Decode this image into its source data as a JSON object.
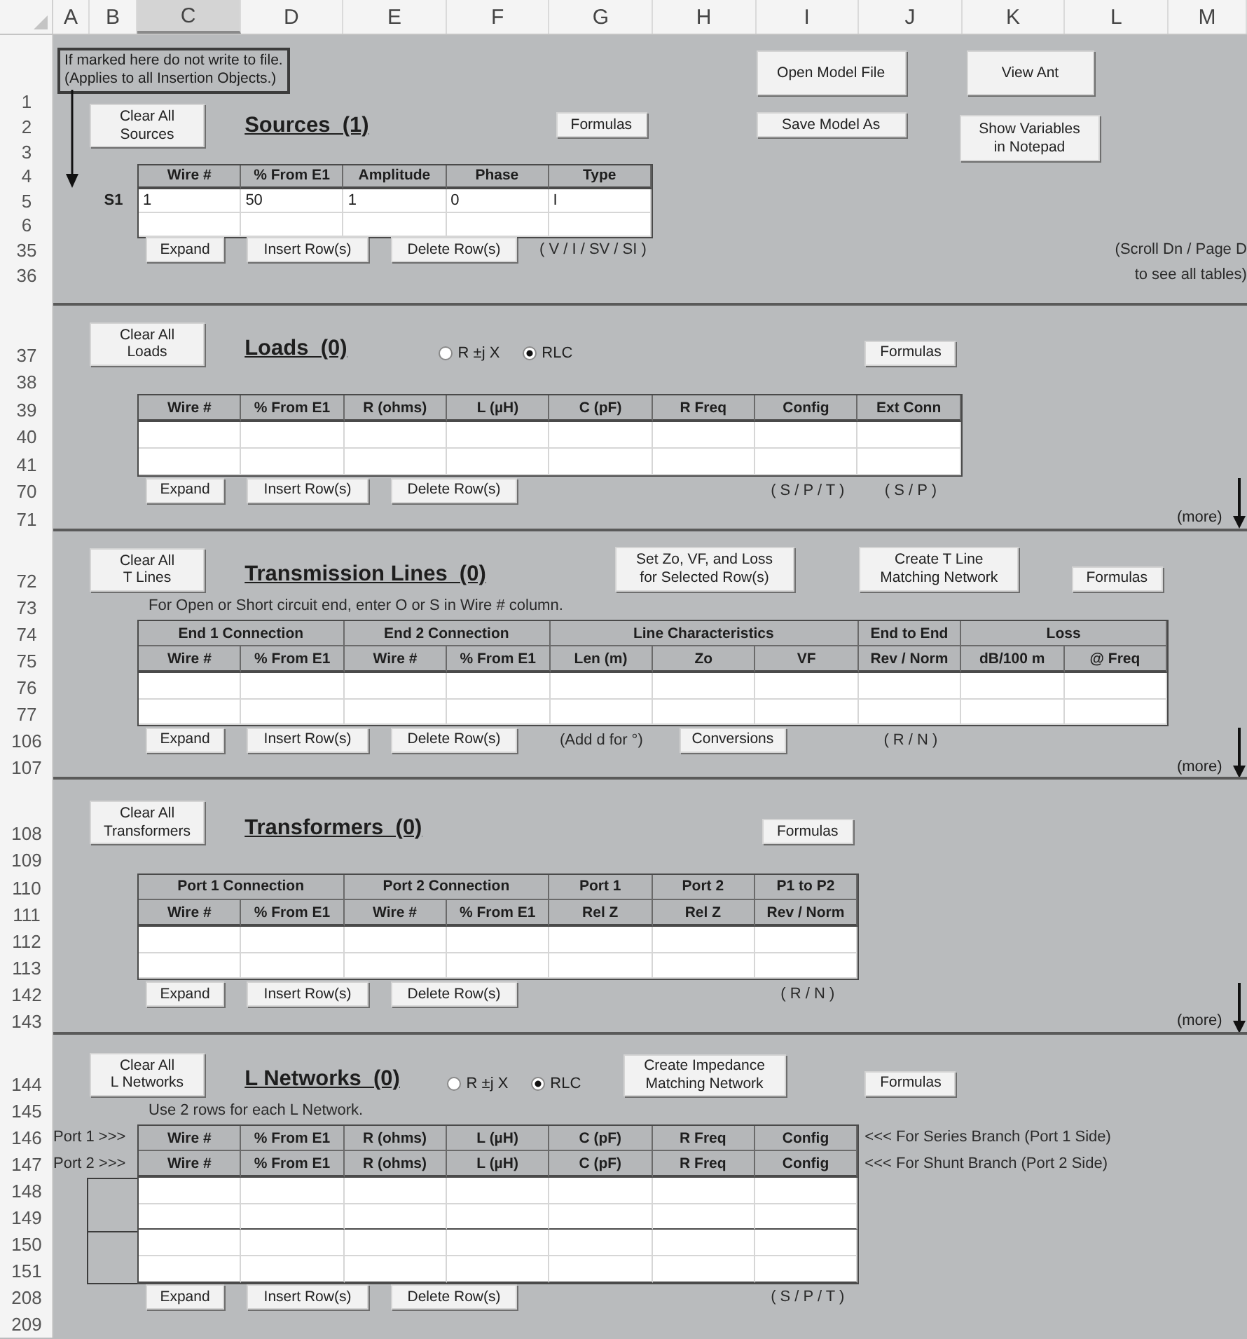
{
  "column_headers": [
    {
      "label": "A",
      "selected": false
    },
    {
      "label": "B",
      "selected": false
    },
    {
      "label": "C",
      "selected": true
    },
    {
      "label": "D",
      "selected": false
    },
    {
      "label": "E",
      "selected": false
    },
    {
      "label": "F",
      "selected": false
    },
    {
      "label": "G",
      "selected": false
    },
    {
      "label": "H",
      "selected": false
    },
    {
      "label": "I",
      "selected": false
    },
    {
      "label": "J",
      "selected": false
    },
    {
      "label": "K",
      "selected": false
    },
    {
      "label": "L",
      "selected": false
    },
    {
      "label": "M",
      "selected": false
    }
  ],
  "sources": {
    "row_numbers": [
      "1",
      "2",
      "3",
      "4",
      "5",
      "6",
      "35",
      "36"
    ],
    "note_box": [
      "If marked here do not write to file.",
      "(Applies to all Insertion Objects.)"
    ],
    "clear_button": [
      "Clear All",
      "Sources"
    ],
    "title": "Sources  (1)",
    "formulas_button": "Formulas",
    "file_buttons": [
      {
        "lines": [
          "Open Model File"
        ]
      },
      {
        "lines": [
          "View Ant"
        ]
      },
      {
        "lines": [
          "Save Model As"
        ]
      },
      {
        "lines": [
          "Show Variables",
          "in Notepad"
        ]
      }
    ],
    "table": {
      "columns": [
        "Wire #",
        "% From E1",
        "Amplitude",
        "Phase",
        "Type"
      ],
      "rows": [
        {
          "label": "S1",
          "cells": [
            "1",
            "50",
            "1",
            "0",
            "I"
          ]
        }
      ]
    },
    "row_buttons": [
      "Expand",
      "Insert Row(s)",
      "Delete Row(s)"
    ],
    "type_hint": "( V / I / SV / SI )",
    "scroll_hint": [
      "(Scroll Dn / Page D",
      "to see all tables)"
    ]
  },
  "loads": {
    "row_numbers": [
      "37",
      "38",
      "39",
      "40",
      "41",
      "70",
      "71"
    ],
    "clear_button": [
      "Clear All",
      "Loads"
    ],
    "title": "Loads  (0)",
    "radios": [
      {
        "label": "R ±j X",
        "selected": false
      },
      {
        "label": "RLC",
        "selected": true
      }
    ],
    "formulas_button": "Formulas",
    "table": {
      "columns": [
        "Wire #",
        "% From E1",
        "R (ohms)",
        "L (µH)",
        "C (pF)",
        "R Freq",
        "Config",
        "Ext Conn"
      ]
    },
    "row_buttons": [
      "Expand",
      "Insert Row(s)",
      "Delete Row(s)"
    ],
    "hints": [
      "( S / P / T )",
      "( S / P )"
    ],
    "more": "(more)"
  },
  "transmission_lines": {
    "row_numbers": [
      "72",
      "73",
      "74",
      "75",
      "76",
      "77",
      "106",
      "107"
    ],
    "clear_button": [
      "Clear All",
      "T Lines"
    ],
    "title": "Transmission Lines  (0)",
    "action_buttons": [
      {
        "lines": [
          "Set Zo, VF, and Loss",
          "for Selected Row(s)"
        ]
      },
      {
        "lines": [
          "Create T Line",
          "Matching Network"
        ]
      }
    ],
    "formulas_button": "Formulas",
    "note": "For Open or Short circuit end, enter O or S in Wire # column.",
    "table": {
      "groups": [
        {
          "label": "End 1 Connection",
          "columns": [
            "Wire #",
            "% From E1"
          ]
        },
        {
          "label": "End 2 Connection",
          "columns": [
            "Wire #",
            "% From E1"
          ]
        },
        {
          "label": "Line Characteristics",
          "columns": [
            "Len (m)",
            "Zo",
            "VF"
          ]
        },
        {
          "label": "End to End",
          "columns": [
            "Rev / Norm"
          ]
        },
        {
          "label": "Loss",
          "columns": [
            "dB/100 m",
            "@ Freq"
          ]
        }
      ]
    },
    "row_buttons": [
      "Expand",
      "Insert Row(s)",
      "Delete Row(s)"
    ],
    "degree_hint": "(Add d for °)",
    "conversions_button": "Conversions",
    "rn_hint": "( R / N )",
    "more": "(more)"
  },
  "transformers": {
    "row_numbers": [
      "108",
      "109",
      "110",
      "111",
      "112",
      "113",
      "142",
      "143"
    ],
    "clear_button": [
      "Clear All",
      "Transformers"
    ],
    "title": "Transformers  (0)",
    "formulas_button": "Formulas",
    "table": {
      "groups": [
        {
          "label": "Port 1 Connection",
          "columns": [
            "Wire #",
            "% From E1"
          ]
        },
        {
          "label": "Port 2 Connection",
          "columns": [
            "Wire #",
            "% From E1"
          ]
        },
        {
          "label": "Port 1",
          "columns": [
            "Rel Z"
          ]
        },
        {
          "label": "Port 2",
          "columns": [
            "Rel Z"
          ]
        },
        {
          "label": "P1 to P2",
          "columns": [
            "Rev / Norm"
          ]
        }
      ]
    },
    "row_buttons": [
      "Expand",
      "Insert Row(s)",
      "Delete Row(s)"
    ],
    "rn_hint": "( R / N )",
    "more": "(more)"
  },
  "l_networks": {
    "row_numbers": [
      "144",
      "145",
      "146",
      "147",
      "148",
      "149",
      "150",
      "151",
      "208",
      "209"
    ],
    "clear_button": [
      "Clear All",
      "L Networks"
    ],
    "title": "L Networks  (0)",
    "radios": [
      {
        "label": "R ±j X",
        "selected": false
      },
      {
        "label": "RLC",
        "selected": true
      }
    ],
    "action_button": [
      "Create Impedance",
      "Matching Network"
    ],
    "formulas_button": "Formulas",
    "note": "Use 2 rows for each L Network.",
    "header_rows": [
      {
        "port": "Port 1 >>>",
        "columns": [
          "Wire #",
          "% From E1",
          "R (ohms)",
          "L (µH)",
          "C (pF)",
          "R Freq",
          "Config"
        ],
        "comment": "<<< For Series Branch (Port 1 Side)"
      },
      {
        "port": "Port 2 >>>",
        "columns": [
          "Wire #",
          "% From E1",
          "R (ohms)",
          "L (µH)",
          "C (pF)",
          "R Freq",
          "Config"
        ],
        "comment": "<<< For Shunt Branch (Port 2 Side)"
      }
    ],
    "row_buttons": [
      "Expand",
      "Insert Row(s)",
      "Delete Row(s)"
    ],
    "config_hint": "( S / P / T )"
  }
}
